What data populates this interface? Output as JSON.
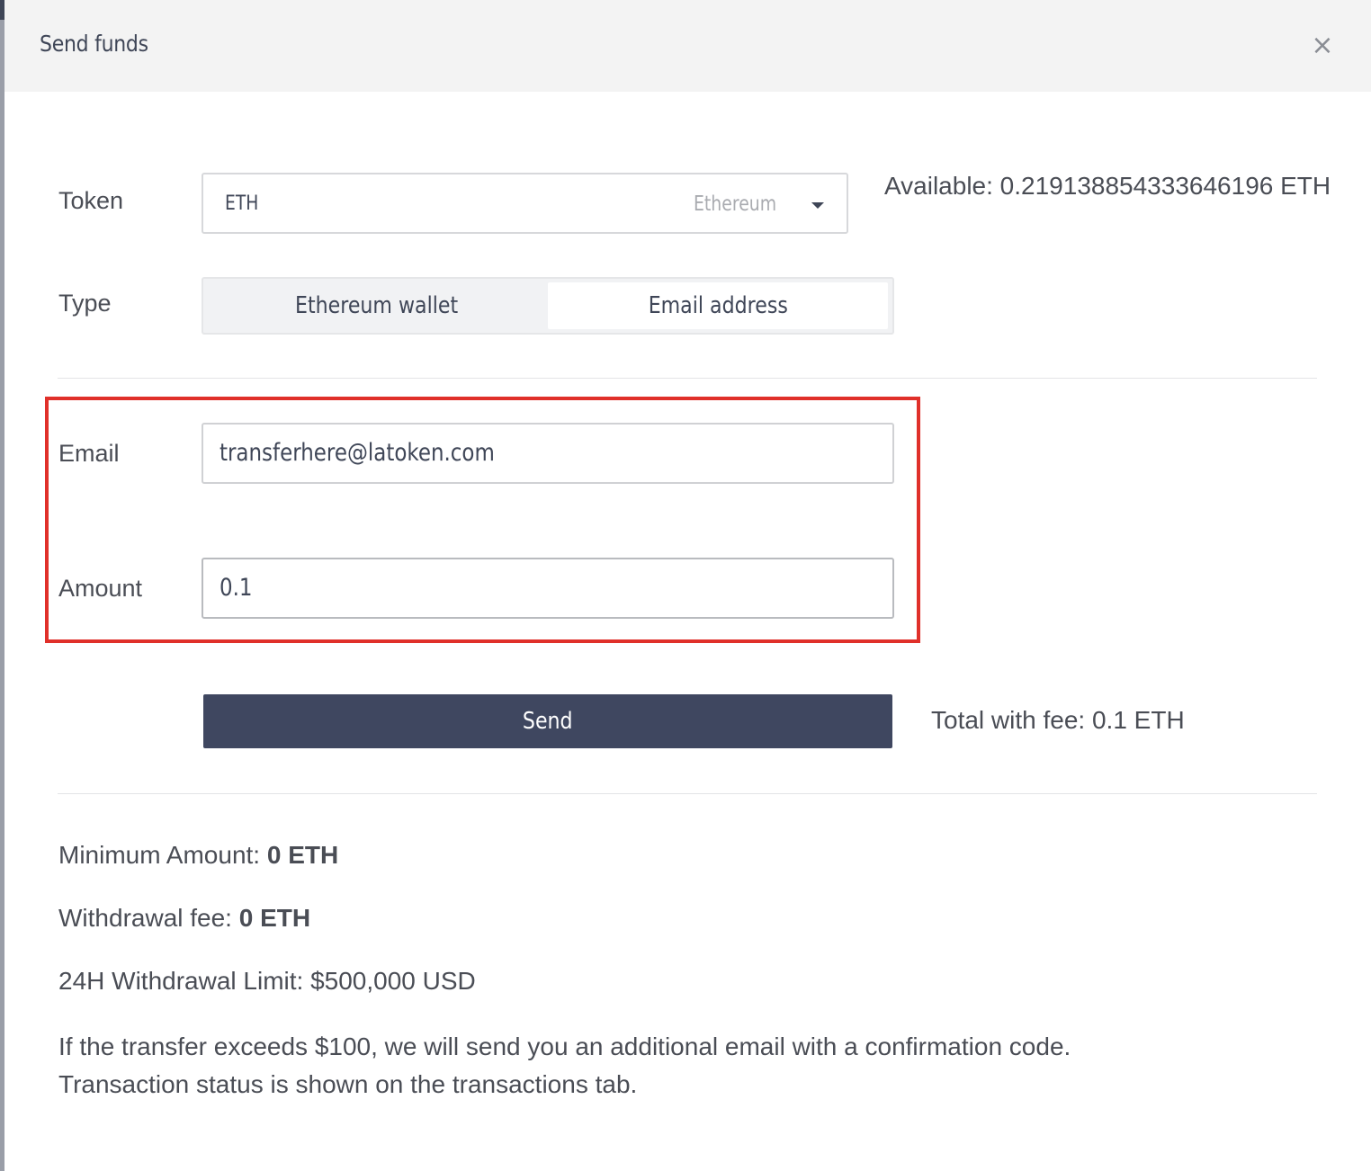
{
  "modal": {
    "title": "Send funds",
    "close_icon": "close-icon"
  },
  "token": {
    "label": "Token",
    "selected_code": "ETH",
    "selected_name": "Ethereum",
    "available": "Available: 0.219138854333646196 ETH"
  },
  "type": {
    "label": "Type",
    "options": [
      "Ethereum wallet",
      "Email address"
    ],
    "selected": "Email address"
  },
  "email": {
    "label": "Email",
    "value": "transferhere@latoken.com"
  },
  "amount": {
    "label": "Amount",
    "value": "0.1"
  },
  "send": {
    "label": "Send",
    "total_with_fee": "Total with fee: 0.1 ETH"
  },
  "info": {
    "minimum_label": "Minimum Amount:",
    "minimum_value": "0 ETH",
    "fee_label": "Withdrawal fee:",
    "fee_value": "0 ETH",
    "limit": "24H Withdrawal Limit: $500,000 USD",
    "notice_line1": "If the transfer exceeds $100, we will send you an additional email with a confirmation code.",
    "notice_line2": "Transaction status is shown on the transactions tab."
  },
  "colors": {
    "primary_button": "#3f4760",
    "highlight_border": "#e0302a",
    "header_bg": "#f3f3f3"
  }
}
